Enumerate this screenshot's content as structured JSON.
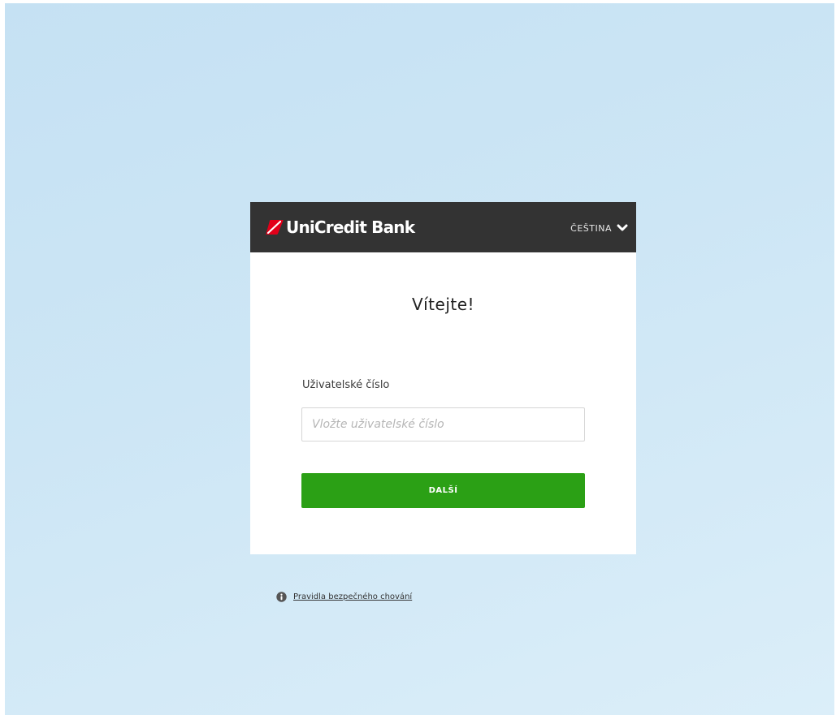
{
  "brand": {
    "name": "UniCredit Bank",
    "logo_icon": "unicredit-logo-icon",
    "accent_color": "#e2001a"
  },
  "header": {
    "language": "ČEŠTINA",
    "language_icon": "chevron-down-icon",
    "background_color": "#333333"
  },
  "login": {
    "title": "Vítejte!",
    "username_label": "Uživatelské číslo",
    "username_value": "",
    "username_placeholder": "Vložte uživatelské číslo",
    "submit_label": "DALŠÍ",
    "submit_color": "#2ba015"
  },
  "footer": {
    "info_icon": "info-icon",
    "safety_link": "Pravidla bezpečného chování"
  }
}
